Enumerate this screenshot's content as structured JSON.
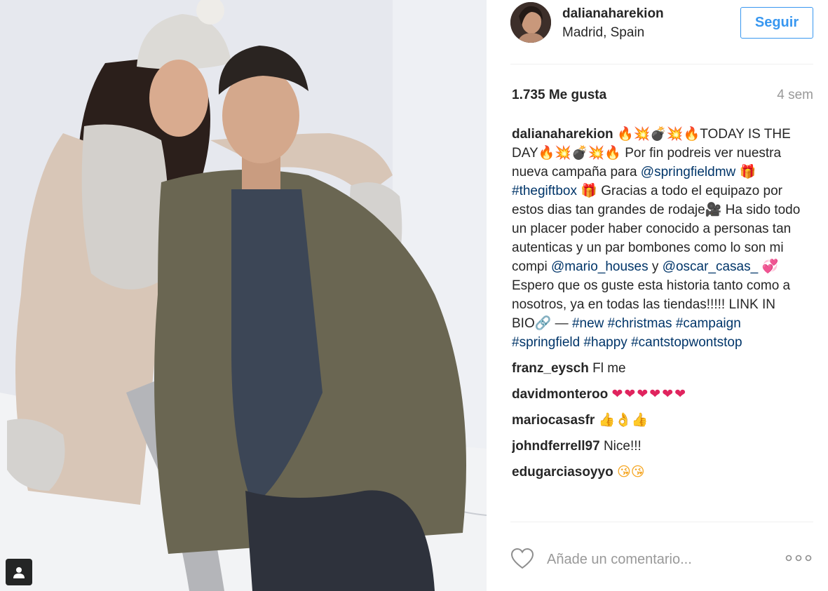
{
  "post": {
    "username": "dalianaharekion",
    "location": "Madrid, Spain",
    "follow_label": "Seguir",
    "likes": "1.735 Me gusta",
    "time_ago": "4 sem"
  },
  "caption": {
    "username": "dalianaharekion",
    "emoji_a": "🔥💥💣💥🔥",
    "text_a": "TODAY IS THE DAY",
    "emoji_b": "🔥💥💣💥🔥",
    "text_b": " Por fin podreis ver nuestra nueva campaña para ",
    "mention_1": "@springfieldmw",
    "gift_1": "🎁",
    "hashtag_giftbox": "#thegiftbox",
    "gift_2": "🎁",
    "text_c": " Gracias a todo el equipazo por estos dias tan grandes de rodaje",
    "camera": "🎥",
    "text_d": " Ha sido todo un placer poder haber conocido a personas tan autenticas y un par bombones como lo son mi compi ",
    "mention_2": "@mario_houses",
    "text_e": " y ",
    "mention_3": "@oscar_casas_",
    "heart": "💞",
    "text_f": " Espero que os guste esta historia tanto como a nosotros, ya en todas las tiendas!!!!! LINK IN BIO",
    "link_emoji": "🔗",
    "text_g": " — ",
    "hashtags": [
      "#new",
      "#christmas",
      "#campaign",
      "#springfield",
      "#happy",
      "#cantstopwontstop"
    ]
  },
  "comments": [
    {
      "username": "franz_eysch",
      "text": "Fl me"
    },
    {
      "username": "davidmonteroo",
      "text": "❤❤❤❤❤❤"
    },
    {
      "username": "mariocasasfr",
      "text": "👍👌👍"
    },
    {
      "username": "johndferrell97",
      "text": "Nice!!!"
    },
    {
      "username": "edugarciasoyyo",
      "text": "😘😘"
    }
  ],
  "footer": {
    "comment_placeholder": "Añade un comentario...",
    "like_icon": "heart-outline-icon",
    "more_icon": "more-options-icon"
  },
  "colors": {
    "link": "#003569",
    "accent": "#3897f0",
    "muted": "#999999",
    "text": "#262626"
  }
}
